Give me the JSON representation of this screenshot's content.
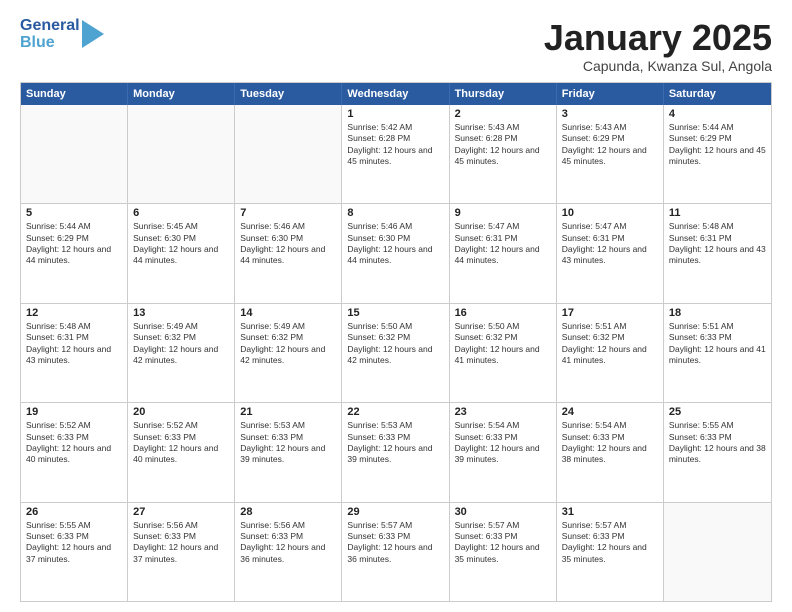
{
  "header": {
    "logo_general": "General",
    "logo_blue": "Blue",
    "month_title": "January 2025",
    "location": "Capunda, Kwanza Sul, Angola"
  },
  "days_of_week": [
    "Sunday",
    "Monday",
    "Tuesday",
    "Wednesday",
    "Thursday",
    "Friday",
    "Saturday"
  ],
  "weeks": [
    [
      {
        "day": "",
        "sunrise": "",
        "sunset": "",
        "daylight": "",
        "empty": true
      },
      {
        "day": "",
        "sunrise": "",
        "sunset": "",
        "daylight": "",
        "empty": true
      },
      {
        "day": "",
        "sunrise": "",
        "sunset": "",
        "daylight": "",
        "empty": true
      },
      {
        "day": "1",
        "sunrise": "Sunrise: 5:42 AM",
        "sunset": "Sunset: 6:28 PM",
        "daylight": "Daylight: 12 hours and 45 minutes.",
        "empty": false
      },
      {
        "day": "2",
        "sunrise": "Sunrise: 5:43 AM",
        "sunset": "Sunset: 6:28 PM",
        "daylight": "Daylight: 12 hours and 45 minutes.",
        "empty": false
      },
      {
        "day": "3",
        "sunrise": "Sunrise: 5:43 AM",
        "sunset": "Sunset: 6:29 PM",
        "daylight": "Daylight: 12 hours and 45 minutes.",
        "empty": false
      },
      {
        "day": "4",
        "sunrise": "Sunrise: 5:44 AM",
        "sunset": "Sunset: 6:29 PM",
        "daylight": "Daylight: 12 hours and 45 minutes.",
        "empty": false
      }
    ],
    [
      {
        "day": "5",
        "sunrise": "Sunrise: 5:44 AM",
        "sunset": "Sunset: 6:29 PM",
        "daylight": "Daylight: 12 hours and 44 minutes.",
        "empty": false
      },
      {
        "day": "6",
        "sunrise": "Sunrise: 5:45 AM",
        "sunset": "Sunset: 6:30 PM",
        "daylight": "Daylight: 12 hours and 44 minutes.",
        "empty": false
      },
      {
        "day": "7",
        "sunrise": "Sunrise: 5:46 AM",
        "sunset": "Sunset: 6:30 PM",
        "daylight": "Daylight: 12 hours and 44 minutes.",
        "empty": false
      },
      {
        "day": "8",
        "sunrise": "Sunrise: 5:46 AM",
        "sunset": "Sunset: 6:30 PM",
        "daylight": "Daylight: 12 hours and 44 minutes.",
        "empty": false
      },
      {
        "day": "9",
        "sunrise": "Sunrise: 5:47 AM",
        "sunset": "Sunset: 6:31 PM",
        "daylight": "Daylight: 12 hours and 44 minutes.",
        "empty": false
      },
      {
        "day": "10",
        "sunrise": "Sunrise: 5:47 AM",
        "sunset": "Sunset: 6:31 PM",
        "daylight": "Daylight: 12 hours and 43 minutes.",
        "empty": false
      },
      {
        "day": "11",
        "sunrise": "Sunrise: 5:48 AM",
        "sunset": "Sunset: 6:31 PM",
        "daylight": "Daylight: 12 hours and 43 minutes.",
        "empty": false
      }
    ],
    [
      {
        "day": "12",
        "sunrise": "Sunrise: 5:48 AM",
        "sunset": "Sunset: 6:31 PM",
        "daylight": "Daylight: 12 hours and 43 minutes.",
        "empty": false
      },
      {
        "day": "13",
        "sunrise": "Sunrise: 5:49 AM",
        "sunset": "Sunset: 6:32 PM",
        "daylight": "Daylight: 12 hours and 42 minutes.",
        "empty": false
      },
      {
        "day": "14",
        "sunrise": "Sunrise: 5:49 AM",
        "sunset": "Sunset: 6:32 PM",
        "daylight": "Daylight: 12 hours and 42 minutes.",
        "empty": false
      },
      {
        "day": "15",
        "sunrise": "Sunrise: 5:50 AM",
        "sunset": "Sunset: 6:32 PM",
        "daylight": "Daylight: 12 hours and 42 minutes.",
        "empty": false
      },
      {
        "day": "16",
        "sunrise": "Sunrise: 5:50 AM",
        "sunset": "Sunset: 6:32 PM",
        "daylight": "Daylight: 12 hours and 41 minutes.",
        "empty": false
      },
      {
        "day": "17",
        "sunrise": "Sunrise: 5:51 AM",
        "sunset": "Sunset: 6:32 PM",
        "daylight": "Daylight: 12 hours and 41 minutes.",
        "empty": false
      },
      {
        "day": "18",
        "sunrise": "Sunrise: 5:51 AM",
        "sunset": "Sunset: 6:33 PM",
        "daylight": "Daylight: 12 hours and 41 minutes.",
        "empty": false
      }
    ],
    [
      {
        "day": "19",
        "sunrise": "Sunrise: 5:52 AM",
        "sunset": "Sunset: 6:33 PM",
        "daylight": "Daylight: 12 hours and 40 minutes.",
        "empty": false
      },
      {
        "day": "20",
        "sunrise": "Sunrise: 5:52 AM",
        "sunset": "Sunset: 6:33 PM",
        "daylight": "Daylight: 12 hours and 40 minutes.",
        "empty": false
      },
      {
        "day": "21",
        "sunrise": "Sunrise: 5:53 AM",
        "sunset": "Sunset: 6:33 PM",
        "daylight": "Daylight: 12 hours and 39 minutes.",
        "empty": false
      },
      {
        "day": "22",
        "sunrise": "Sunrise: 5:53 AM",
        "sunset": "Sunset: 6:33 PM",
        "daylight": "Daylight: 12 hours and 39 minutes.",
        "empty": false
      },
      {
        "day": "23",
        "sunrise": "Sunrise: 5:54 AM",
        "sunset": "Sunset: 6:33 PM",
        "daylight": "Daylight: 12 hours and 39 minutes.",
        "empty": false
      },
      {
        "day": "24",
        "sunrise": "Sunrise: 5:54 AM",
        "sunset": "Sunset: 6:33 PM",
        "daylight": "Daylight: 12 hours and 38 minutes.",
        "empty": false
      },
      {
        "day": "25",
        "sunrise": "Sunrise: 5:55 AM",
        "sunset": "Sunset: 6:33 PM",
        "daylight": "Daylight: 12 hours and 38 minutes.",
        "empty": false
      }
    ],
    [
      {
        "day": "26",
        "sunrise": "Sunrise: 5:55 AM",
        "sunset": "Sunset: 6:33 PM",
        "daylight": "Daylight: 12 hours and 37 minutes.",
        "empty": false
      },
      {
        "day": "27",
        "sunrise": "Sunrise: 5:56 AM",
        "sunset": "Sunset: 6:33 PM",
        "daylight": "Daylight: 12 hours and 37 minutes.",
        "empty": false
      },
      {
        "day": "28",
        "sunrise": "Sunrise: 5:56 AM",
        "sunset": "Sunset: 6:33 PM",
        "daylight": "Daylight: 12 hours and 36 minutes.",
        "empty": false
      },
      {
        "day": "29",
        "sunrise": "Sunrise: 5:57 AM",
        "sunset": "Sunset: 6:33 PM",
        "daylight": "Daylight: 12 hours and 36 minutes.",
        "empty": false
      },
      {
        "day": "30",
        "sunrise": "Sunrise: 5:57 AM",
        "sunset": "Sunset: 6:33 PM",
        "daylight": "Daylight: 12 hours and 35 minutes.",
        "empty": false
      },
      {
        "day": "31",
        "sunrise": "Sunrise: 5:57 AM",
        "sunset": "Sunset: 6:33 PM",
        "daylight": "Daylight: 12 hours and 35 minutes.",
        "empty": false
      },
      {
        "day": "",
        "sunrise": "",
        "sunset": "",
        "daylight": "",
        "empty": true
      }
    ]
  ]
}
